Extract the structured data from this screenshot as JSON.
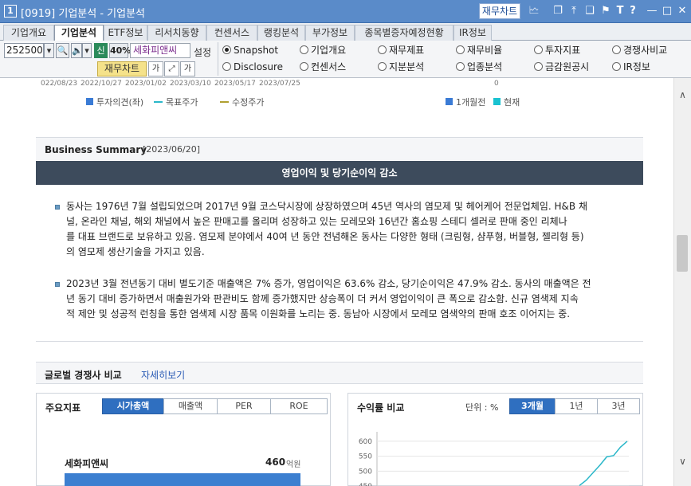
{
  "window": {
    "number": "1",
    "title": "[0919] 기업분석 - 기업분석",
    "fin_chart_label": "재무차트",
    "icons": [
      "chart-icon",
      "minimize-tool-icon",
      "pin-icon",
      "restore-tool-icon",
      "flag-icon",
      "font-icon",
      "help-icon",
      "minimize-icon",
      "maximize-icon",
      "close-icon"
    ]
  },
  "tabs": [
    {
      "label": "기업개요",
      "active": false
    },
    {
      "label": "기업분석",
      "active": true
    },
    {
      "label": "ETF정보",
      "active": false
    },
    {
      "label": "리서치동향",
      "active": false
    },
    {
      "label": "컨센서스",
      "active": false
    },
    {
      "label": "랭킹분석",
      "active": false
    },
    {
      "label": "부가정보",
      "active": false
    },
    {
      "label": "종목별증자예정현황",
      "active": false
    },
    {
      "label": "IR정보",
      "active": false
    }
  ],
  "toolbar": {
    "stock_code": "252500",
    "credit_label": "신",
    "margin_pct": "40%",
    "stock_name": "세화피앤씨",
    "settings_label": "설정",
    "fin_chart_label": "재무차트",
    "font_label": "가",
    "radios_row1": [
      {
        "label": "Snapshot",
        "checked": true
      },
      {
        "label": "기업개요",
        "checked": false
      },
      {
        "label": "재무제표",
        "checked": false
      },
      {
        "label": "재무비율",
        "checked": false
      },
      {
        "label": "투자지표",
        "checked": false
      },
      {
        "label": "경쟁사비교",
        "checked": false
      }
    ],
    "radios_row2": [
      {
        "label": "Disclosure",
        "checked": false
      },
      {
        "label": "컨센서스",
        "checked": false
      },
      {
        "label": "지분분석",
        "checked": false
      },
      {
        "label": "업종분석",
        "checked": false
      },
      {
        "label": "금감원공시",
        "checked": false
      },
      {
        "label": "IR정보",
        "checked": false
      }
    ]
  },
  "top_chart": {
    "dates": [
      "022/08/23",
      "2022/10/27",
      "2023/01/02",
      "2023/03/10",
      "2023/05/17",
      "2023/07/25"
    ],
    "zero_label": "0",
    "legend_left": [
      {
        "label": "투자의견(좌)",
        "color": "#3a7bd5",
        "kind": "square"
      },
      {
        "label": "목표주가",
        "color": "#2ab7c9",
        "kind": "line"
      },
      {
        "label": "수정주가",
        "color": "#b0a030",
        "kind": "line"
      }
    ],
    "legend_right": [
      {
        "label": "1개월전",
        "color": "#3a7bd5"
      },
      {
        "label": "현재",
        "color": "#19c2d0"
      }
    ]
  },
  "business_summary": {
    "title": "Business Summary",
    "date": "[2023/06/20]",
    "headline": "영업이익 및 당기순이익 감소",
    "paragraphs": [
      {
        "lines": [
          "동사는 1976년 7월 설립되었으며 2017년 9월 코스닥시장에 상장하였으며 45년 역사의 염모제 및 헤어케어 전문업체임. H&B 채",
          "널, 온라인 채널, 해외 채널에서 높은 판매고를 올리며 성장하고 있는 모레모와 16년간 홈쇼핑 스테디 셀러로 판매 중인 리체나",
          "를 대표 브랜드로 보유하고 있음. 염모제 분야에서 40여 년 동안 전념해온 동사는 다양한 형태 (크림형, 샴푸형, 버블형, 젤리형 등)",
          "의 염모제 생산기술을 가지고 있음."
        ]
      },
      {
        "lines": [
          "2023년 3월 전년동기 대비 별도기준 매출액은 7% 증가, 영업이익은 63.6% 감소, 당기순이익은 47.9% 감소. 동사의 매출액은 전",
          "년 동기 대비 증가하면서 매출원가와 판관비도 함께 증가했지만 상승폭이 더 커서 영업이익이 큰 폭으로 감소함. 신규 염색제 지속",
          "적 제안 및 성공적 런칭을 통한 염색제 시장 품목 이원화를 노리는 중. 동남아 시장에서 모레모 염색약의 판매 호조 이어지는 중."
        ]
      }
    ]
  },
  "global_comp": {
    "title": "글로벌 경쟁사 비교",
    "detail_link": "자세히보기"
  },
  "key_metrics": {
    "title": "주요지표",
    "tabs": [
      {
        "label": "시가총액",
        "active": true
      },
      {
        "label": "매출액",
        "active": false
      },
      {
        "label": "PER",
        "active": false
      },
      {
        "label": "ROE",
        "active": false
      }
    ],
    "company": "세화피앤씨",
    "value": "460",
    "unit": "억원",
    "bar_fraction": 1.0,
    "bar_color": "#3c7fd0"
  },
  "returns": {
    "title": "수익률 비교",
    "unit_label": "단위 : %",
    "tabs": [
      {
        "label": "3개월",
        "active": true
      },
      {
        "label": "1년",
        "active": false
      },
      {
        "label": "3년",
        "active": false
      }
    ],
    "chart_data": {
      "type": "line",
      "yticks": [
        600,
        550,
        500,
        450
      ],
      "ylim": [
        440,
        610
      ],
      "series": [
        {
          "color": "#2ab7c9",
          "values": [
            452,
            470,
            495,
            520,
            548,
            552,
            580,
            600
          ]
        }
      ]
    }
  }
}
